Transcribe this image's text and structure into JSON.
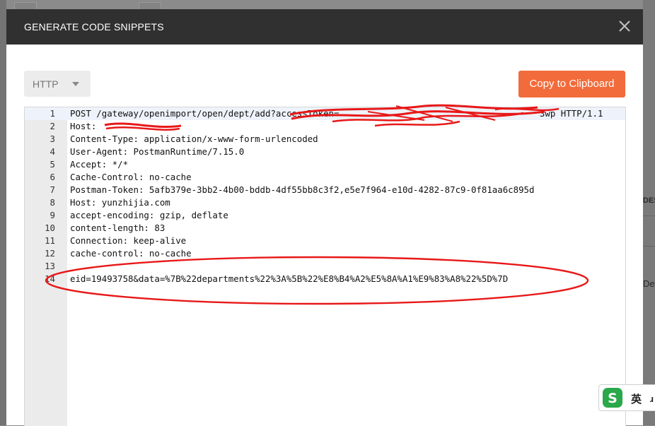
{
  "dialog": {
    "title": "GENERATE CODE SNIPPETS",
    "close_icon": "close-icon"
  },
  "language": {
    "selected": "HTTP",
    "caret_icon": "chevron-down-icon"
  },
  "copy_button": {
    "label": "Copy to Clipboard",
    "color": "#f26b3a"
  },
  "code": {
    "lines": [
      {
        "n": "1",
        "text": "POST /gateway/openimport/open/dept/add?accessToken=                                      3wp HTTP/1.1"
      },
      {
        "n": "2",
        "text": "Host: "
      },
      {
        "n": "3",
        "text": "Content-Type: application/x-www-form-urlencoded"
      },
      {
        "n": "4",
        "text": "User-Agent: PostmanRuntime/7.15.0"
      },
      {
        "n": "5",
        "text": "Accept: */*"
      },
      {
        "n": "6",
        "text": "Cache-Control: no-cache"
      },
      {
        "n": "7",
        "text": "Postman-Token: 5afb379e-3bb2-4b00-bddb-4df55bb8c3f2,e5e7f964-e10d-4282-87c9-0f81aa6c895d"
      },
      {
        "n": "8",
        "text": "Host: yunzhijia.com"
      },
      {
        "n": "9",
        "text": "accept-encoding: gzip, deflate"
      },
      {
        "n": "10",
        "text": "content-length: 83"
      },
      {
        "n": "11",
        "text": "Connection: keep-alive"
      },
      {
        "n": "12",
        "text": "cache-control: no-cache"
      },
      {
        "n": "13",
        "text": ""
      },
      {
        "n": "14",
        "text": "eid=19493758&data=%7B%22departments%22%3A%5B%22%E8%B4%A2%E5%8A%A1%E9%83%A8%22%5D%7D"
      }
    ]
  },
  "ime": {
    "lang": "英",
    "logo_icon": "sogou-ime-icon"
  },
  "background": {
    "side_text": "DES",
    "side_text2": "De"
  }
}
